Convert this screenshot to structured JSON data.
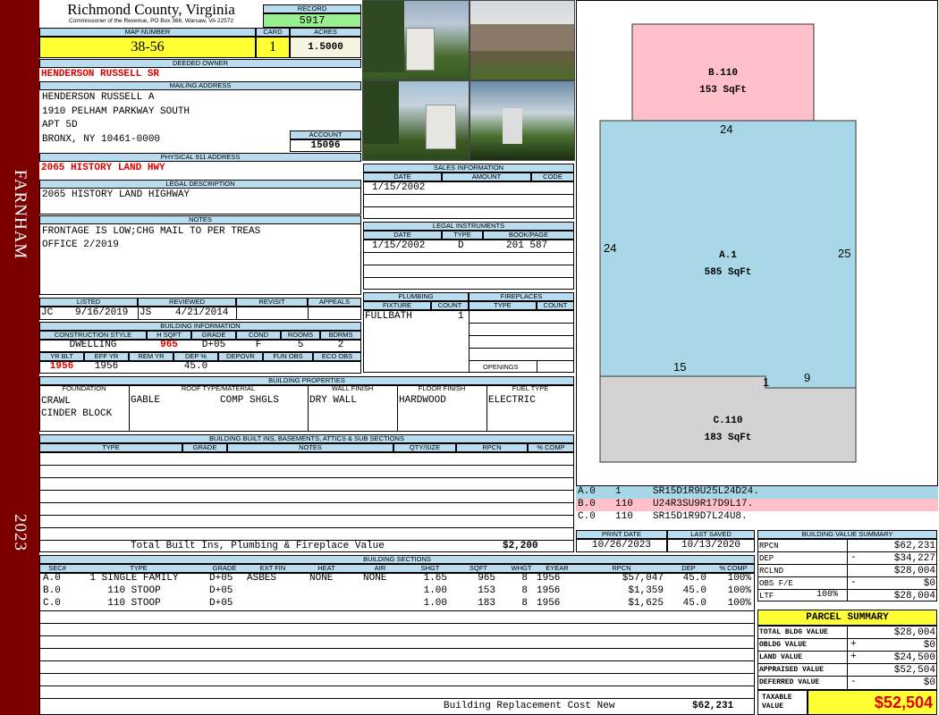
{
  "side": {
    "district": "FARNHAM",
    "year": "2023"
  },
  "title": {
    "county": "Richmond County, Virginia",
    "address": "Commissioner of the Revenue, PO Box 366, Warsaw, VA 22572"
  },
  "record": {
    "label": "RECORD",
    "value": "5917"
  },
  "map": {
    "label": "MAP NUMBER",
    "value": "38-56",
    "card_label": "CARD",
    "card": "1",
    "acres_label": "ACRES",
    "acres": "1.5000"
  },
  "owner": {
    "label": "DEEDED OWNER",
    "value": "HENDERSON RUSSELL SR"
  },
  "mailing": {
    "label": "MAILING ADDRESS",
    "line1": "HENDERSON RUSSELL A",
    "line2": "1910 PELHAM PARKWAY SOUTH",
    "line3": "APT 5D",
    "line4": "BRONX, NY 10461-0000",
    "account_label": "ACCOUNT",
    "account": "15096"
  },
  "physical": {
    "label": "PHYSICAL 911 ADDRESS",
    "value": "2065 HISTORY LAND HWY"
  },
  "legal": {
    "label": "LEGAL DESCRIPTION",
    "value": "2065 HISTORY LAND HIGHWAY"
  },
  "notes": {
    "label": "NOTES",
    "line1": "FRONTAGE IS LOW;CHG MAIL TO PER TREAS",
    "line2": "OFFICE 2/2019"
  },
  "dates": {
    "listed_label": "LISTED",
    "listed_by": "JC",
    "listed": "9/16/2019",
    "reviewed_label": "REVIEWED",
    "reviewed_by": "JS",
    "reviewed": "4/21/2014",
    "revisit_label": "REVISIT",
    "appeals_label": "APPEALS"
  },
  "bldg_info": {
    "label": "BUILDING INFORMATION",
    "h": {
      "style": "CONSTRUCTION STYLE",
      "hsqft": "H SQFT",
      "grade": "GRADE",
      "cond": "COND",
      "rooms": "ROOMS",
      "bdrms": "BDRMS",
      "yrblt": "YR BLT",
      "effyr": "EFF YR",
      "remyr": "REM YR",
      "dep": "DEP %",
      "depovr": "DEPOVR",
      "funobs": "FUN OBS",
      "ecoobs": "ECO OBS"
    },
    "style": "DWELLING",
    "hsqft": "965",
    "grade": "D+05",
    "cond": "F",
    "rooms": "5",
    "bdrms": "2",
    "yrblt": "1956",
    "effyr": "1956",
    "dep": "45.0"
  },
  "sales": {
    "label": "SALES INFORMATION",
    "h_date": "DATE",
    "h_amount": "AMOUNT",
    "h_code": "CODE",
    "date": "1/15/2002"
  },
  "instruments": {
    "label": "LEGAL INSTRUMENTS",
    "h_date": "DATE",
    "h_type": "TYPE",
    "h_book": "BOOK/PAGE",
    "date": "1/15/2002",
    "type": "D",
    "book": "201 587"
  },
  "plumbing": {
    "label": "PLUMBING",
    "h_fixture": "FIXTURE",
    "h_count": "COUNT",
    "fixture": "FULLBATH",
    "count": "1"
  },
  "fireplaces": {
    "label": "FIREPLACES",
    "h_type": "TYPE",
    "h_count": "COUNT",
    "openings": "OPENINGS"
  },
  "properties": {
    "label": "BUILDING PROPERTIES",
    "h_found": "FOUNDATION",
    "h_roof": "ROOF TYPE/MATERIAL",
    "h_wall": "WALL FINISH",
    "h_floor": "FLOOR FINISH",
    "h_fuel": "FUEL TYPE",
    "found1": "CRAWL",
    "found2": "CINDER BLOCK",
    "roof_type": "GABLE",
    "roof_mat": "COMP SHGLS",
    "wall": "DRY WALL",
    "floor": "HARDWOOD",
    "fuel": "ELECTRIC"
  },
  "builtins": {
    "label": "BUILDING BUILT INS, BASEMENTS, ATTICS & SUB SECTIONS",
    "h_type": "TYPE",
    "h_grade": "GRADE",
    "h_notes": "NOTES",
    "h_qty": "QTY/SIZE",
    "h_rpcn": "RPCN",
    "h_comp": "% COMP",
    "total_label": "Total Built Ins, Plumbing & Fireplace Value",
    "total": "$2,200"
  },
  "sections": {
    "label": "BUILDING SECTIONS",
    "headers": [
      "SEC#",
      "TYPE",
      "GRADE",
      "EXT FIN",
      "HEAT",
      "AIR",
      "SHGT",
      "SQFT",
      "WHGT",
      "EYEAR",
      "RPCN",
      "DEP",
      "% COMP"
    ],
    "rows": [
      {
        "sec": "A.0",
        "type": "1 SINGLE FAMILY",
        "grade": "D+05",
        "ext": "ASBES",
        "heat": "NONE",
        "air": "NONE",
        "shgt": "1.65",
        "sqft": "965",
        "whgt": "8",
        "eyear": "1956",
        "rpcn": "$57,047",
        "dep": "45.0",
        "comp": "100%"
      },
      {
        "sec": "B.0",
        "type": "110 STOOP",
        "grade": "D+05",
        "ext": "",
        "heat": "",
        "air": "",
        "shgt": "1.00",
        "sqft": "153",
        "whgt": "8",
        "eyear": "1956",
        "rpcn": "$1,359",
        "dep": "45.0",
        "comp": "100%"
      },
      {
        "sec": "C.0",
        "type": "110 STOOP",
        "grade": "D+05",
        "ext": "",
        "heat": "",
        "air": "",
        "shgt": "1.00",
        "sqft": "183",
        "whgt": "8",
        "eyear": "1956",
        "rpcn": "$1,625",
        "dep": "45.0",
        "comp": "100%"
      }
    ],
    "replacement_label": "Building Replacement Cost New",
    "replacement": "$62,231"
  },
  "sketch": {
    "b_label": "B.110",
    "b_area": "153 SqFt",
    "a_label": "A.1",
    "a_area": "585 SqFt",
    "c_label": "C.110",
    "c_area": "183 SqFt",
    "dim_top": "24",
    "dim_left": "24",
    "dim_right": "25",
    "dim_15": "15",
    "dim_1": "1",
    "dim_9": "9",
    "colors": {
      "b": "#ffc0cb",
      "a": "#a8d8e8",
      "c": "#d3d3d3"
    },
    "codes": [
      {
        "sec": "A.0",
        "n": "1",
        "code": "SR15D1R9U25L24D24."
      },
      {
        "sec": "B.0",
        "n": "110",
        "code": "U24R3SU9R17D9L17."
      },
      {
        "sec": "C.0",
        "n": "110",
        "code": "SR15D1R9D7L24U8."
      }
    ]
  },
  "print": {
    "print_label": "PRINT DATE",
    "print": "10/26/2023",
    "saved_label": "LAST SAVED",
    "saved": "10/13/2020"
  },
  "bvs": {
    "label": "BUILDING VALUE SUMMARY",
    "rpcn_l": "RPCN",
    "rpcn": "$62,231",
    "dep_l": "DEP",
    "dep_s": "-",
    "dep": "$34,227",
    "rclnd_l": "RCLND",
    "rclnd": "$28,004",
    "obs_l": "OBS F/E",
    "obs_s": "-",
    "obs": "$0",
    "ltf_l": "LTF",
    "ltf_p": "100%",
    "ltf": "$28,004"
  },
  "parcel": {
    "label": "PARCEL SUMMARY",
    "tbv_l": "TOTAL BLDG VALUE",
    "tbv": "$28,004",
    "obldg_l": "OBLDG VALUE",
    "obldg_s": "+",
    "obldg": "$0",
    "land_l": "LAND VALUE",
    "land_s": "+",
    "land": "$24,500",
    "appr_l": "APPRAISED VALUE",
    "appr": "$52,504",
    "def_l": "DEFERRED VALUE",
    "def_s": "-",
    "def": "$0",
    "tax_l1": "TAXABLE",
    "tax_l2": "VALUE",
    "tax": "$52,504"
  }
}
